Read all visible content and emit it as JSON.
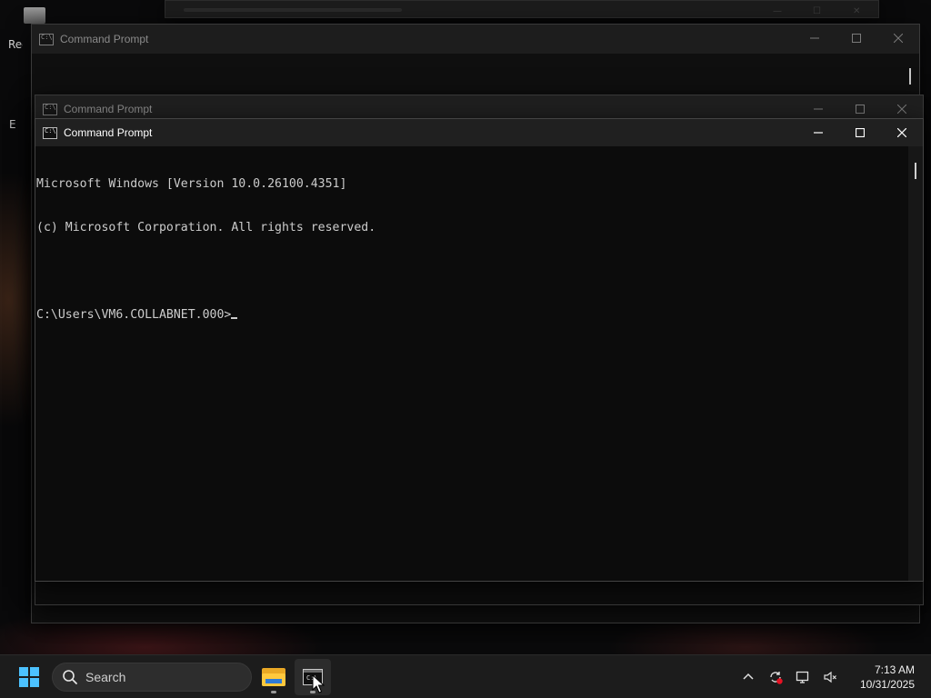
{
  "desktop": {
    "icon_label_partial": "Rec",
    "icon_label2_partial": "E"
  },
  "windows": [
    {
      "id": "back",
      "title": "",
      "state": "inactive"
    },
    {
      "id": "win1",
      "title": "Command Prompt",
      "state": "inactive"
    },
    {
      "id": "win2",
      "title": "Command Prompt",
      "state": "inactive"
    },
    {
      "id": "win3",
      "title": "Command Prompt",
      "state": "active",
      "console_lines": [
        "Microsoft Windows [Version 10.0.26100.4351]",
        "(c) Microsoft Corporation. All rights reserved.",
        "",
        "C:\\Users\\VM6.COLLABNET.000>"
      ]
    }
  ],
  "caption_buttons": [
    "minimize-icon",
    "maximize-icon",
    "close-icon"
  ],
  "taskbar": {
    "start_icon": "windows-logo-icon",
    "search_placeholder": "Search",
    "apps": [
      {
        "name": "File Explorer",
        "icon": "folder-icon"
      },
      {
        "name": "Command Prompt",
        "icon": "cmd-icon",
        "active": true
      }
    ],
    "tray_icons": [
      "chevron-up-icon",
      "sync-icon",
      "network-icon",
      "volume-muted-icon"
    ],
    "clock": {
      "time": "7:13 AM",
      "date": "10/31/2025"
    }
  },
  "colors": {
    "console_bg": "#0c0c0c",
    "console_fg": "#cccccc",
    "titlebar": "#202020",
    "taskbar": "#1c1c1c",
    "accent": "#4cc2ff",
    "sync_badge": "#e81123"
  }
}
